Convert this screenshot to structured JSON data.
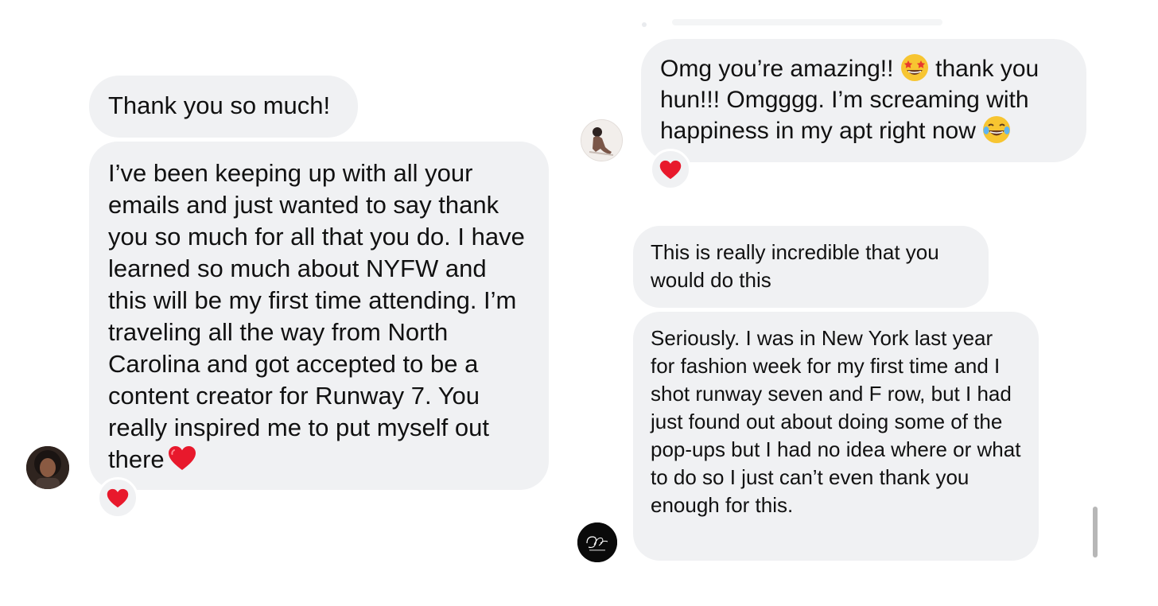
{
  "left_conversation": {
    "messages": [
      {
        "text": "Thank you so much!"
      },
      {
        "text": "I’ve been keeping up with all your emails and just wanted to say thank you so much for all that you do. I have learned so much about NYFW and this will be my first time attending. I’m traveling all the way from North Carolina and got accepted to be a content creator for Runway 7. You really inspired me to put myself out there"
      }
    ],
    "reaction": "❤️"
  },
  "right_conversation": {
    "messages": [
      {
        "text_part1": "Omg you’re amazing!! ",
        "text_part2": " thank you hun!!! Omgggg. I’m screaming with happiness in my apt right now "
      },
      {
        "text": "This is really incredible that you would do this"
      },
      {
        "text": "Seriously. I was in New York last year for fashion week for my first time and I shot runway seven and F row, but I had just found out about doing some of the pop-ups but I had no idea where or what to do so I just can’t even thank you enough for this."
      }
    ],
    "reaction": "❤️"
  },
  "icons": {
    "heart": "heart-icon",
    "star_struck": "star-struck-emoji-icon",
    "laughing": "tears-of-joy-emoji-icon"
  },
  "colors": {
    "bubble_bg": "#f0f1f3",
    "heart_red": "#e8192c"
  }
}
